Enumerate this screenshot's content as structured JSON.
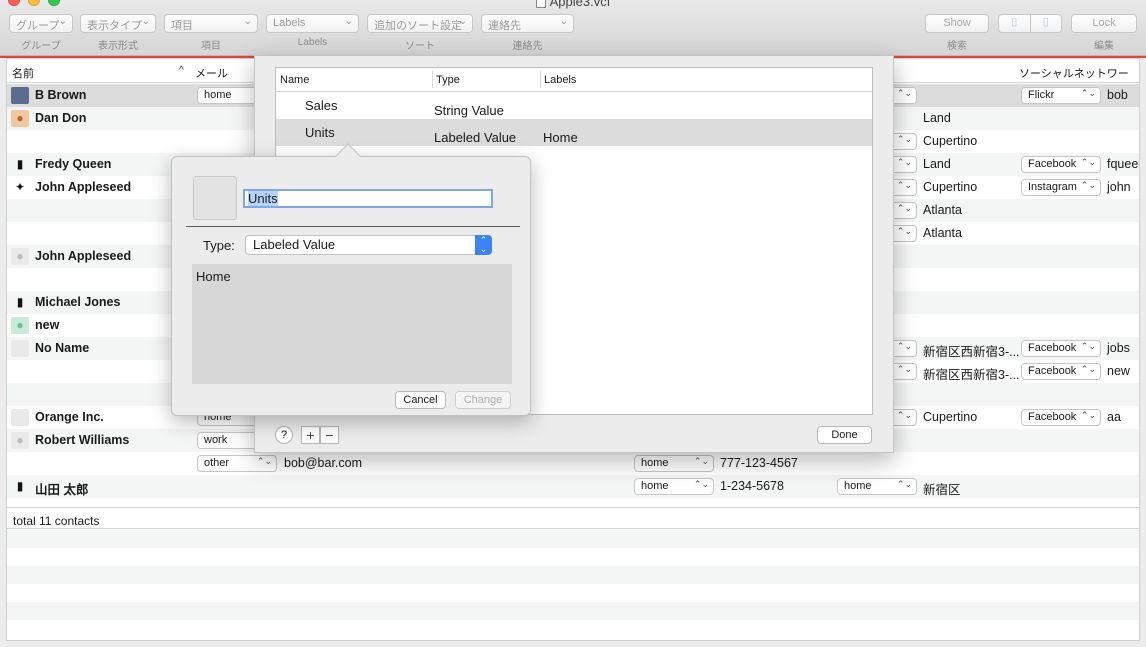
{
  "window": {
    "title": "Apple3.vcf"
  },
  "toolbar": {
    "group_select": "グループ",
    "group_caption": "グループ",
    "display_select": "表示タイプ",
    "display_caption": "表示形式",
    "item_select": "項目",
    "item_caption": "項目",
    "labels_select": "Labels",
    "labels_caption": "Labels",
    "sort_select": "追加のソート設定",
    "sort_caption": "ソート",
    "contacts_select": "連絡先",
    "contacts_caption": "連絡先",
    "show_label": "Show",
    "search_caption": "検索",
    "lock_label": "Lock",
    "edit_caption": "編集"
  },
  "table": {
    "col_name": "名前",
    "col_mail": "メール",
    "col_social": "ソーシャルネットワーク",
    "sort_indicator": "^",
    "rows": [
      {
        "name": "B Brown",
        "mail_label": "home",
        "c3": "",
        "c4": "",
        "social": "Flickr",
        "social_id": "bob"
      },
      {
        "name": "Dan Don",
        "c4": "Land"
      },
      {
        "name": "",
        "c4": "Cupertino"
      },
      {
        "name": "Fredy Queen",
        "c4": "Land",
        "social": "Facebook",
        "social_id": "fqueen"
      },
      {
        "name": "John Appleseed",
        "c4": "Cupertino",
        "social": "Instagram",
        "social_id": "john"
      },
      {
        "name": "",
        "c4": "Atlanta"
      },
      {
        "name": "",
        "c4": "Atlanta"
      },
      {
        "name": "John Appleseed"
      },
      {
        "name": ""
      },
      {
        "name": "Michael Jones"
      },
      {
        "name": "new"
      },
      {
        "name": "No Name",
        "c4": "新宿区西新宿3-...",
        "social": "Facebook",
        "social_id": "jobs"
      },
      {
        "name": "",
        "c4": "新宿区西新宿3-...",
        "social": "Facebook",
        "social_id": "new"
      },
      {
        "name": ""
      },
      {
        "name": "Orange Inc.",
        "mail_label": "home",
        "c4": "Cupertino",
        "social": "Facebook",
        "social_id": "aa"
      },
      {
        "name": "Robert Williams",
        "mail_label": "work"
      },
      {
        "name": "",
        "mail_label": "other",
        "mail": "bob@bar.com",
        "phone_label": "home",
        "phone": "777-123-4567"
      },
      {
        "name": "山田 太郎",
        "phone_label": "home",
        "phone": "1-234-5678",
        "addr_label": "home",
        "addr": "新宿区"
      }
    ],
    "footer": "total 11 contacts"
  },
  "sheet": {
    "col_name": "Name",
    "col_type": "Type",
    "col_labels": "Labels",
    "items": [
      {
        "name": "Sales",
        "type": "String Value",
        "labels": ""
      },
      {
        "name": "Units",
        "type": "Labeled Value",
        "labels": "Home"
      }
    ],
    "help": "?",
    "plus": "+",
    "minus": "−",
    "done": "Done"
  },
  "popover": {
    "name_value": "Units",
    "type_label": "Type:",
    "type_value": "Labeled Value",
    "text_value": "Home",
    "cancel": "Cancel",
    "change": "Change"
  },
  "colors": {
    "accent": "#3b82f6",
    "red_line": "#e8433b",
    "selection": "#dcdcdc"
  }
}
